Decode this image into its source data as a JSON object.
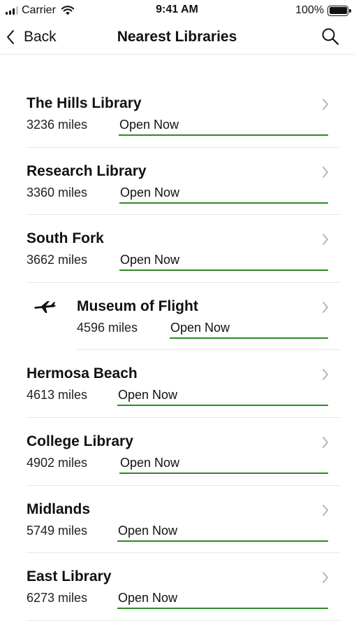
{
  "status_bar": {
    "carrier": "Carrier",
    "time": "9:41 AM",
    "battery": "100%"
  },
  "nav": {
    "back_label": "Back",
    "title": "Nearest Libraries",
    "search_icon": "search-icon"
  },
  "colors": {
    "accent_underline": "#2e8b23",
    "separator": "#e8e8e8"
  },
  "libraries": [
    {
      "name": "The Hills Library",
      "distance": "3236 miles",
      "status": "Open Now"
    },
    {
      "name": "Research Library",
      "distance": "3360 miles",
      "status": "Open Now"
    },
    {
      "name": "South Fork",
      "distance": "3662 miles",
      "status": "Open Now"
    },
    {
      "name": "Museum of Flight",
      "distance": "4596 miles",
      "status": "Open Now",
      "icon": "airplane-icon"
    },
    {
      "name": "Hermosa Beach",
      "distance": "4613 miles",
      "status": "Open Now"
    },
    {
      "name": "College Library",
      "distance": "4902 miles",
      "status": "Open Now"
    },
    {
      "name": "Midlands",
      "distance": "5749 miles",
      "status": "Open Now"
    },
    {
      "name": "East Library",
      "distance": "6273 miles",
      "status": "Open Now"
    }
  ]
}
